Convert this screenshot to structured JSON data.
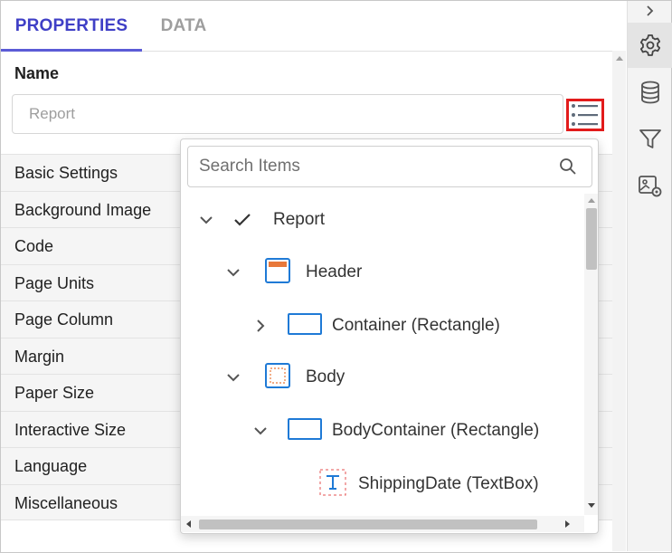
{
  "tabs": [
    {
      "label": "PROPERTIES",
      "active": true
    },
    {
      "label": "DATA",
      "active": false
    }
  ],
  "name_section": {
    "label": "Name",
    "input_value": "Report"
  },
  "property_categories": [
    "Basic Settings",
    "Background Image",
    "Code",
    "Page Units",
    "Page Column",
    "Margin",
    "Paper Size",
    "Interactive Size",
    "Language",
    "Miscellaneous"
  ],
  "item_picker": {
    "search_placeholder": "Search Items",
    "tree": [
      {
        "label": "Report",
        "icon": "check-icon",
        "expanded": true,
        "selected": true
      },
      {
        "label": "Header",
        "icon": "header-section-icon",
        "expanded": true
      },
      {
        "label": "Container (Rectangle)",
        "icon": "rectangle-icon",
        "expanded": false
      },
      {
        "label": "Body",
        "icon": "body-section-icon",
        "expanded": true
      },
      {
        "label": "BodyContainer (Rectangle)",
        "icon": "rectangle-icon",
        "expanded": true
      },
      {
        "label": "ShippingDate (TextBox)",
        "icon": "textbox-icon",
        "expanded": null
      }
    ]
  },
  "right_rail": [
    "collapse-chevron-icon",
    "gear-icon",
    "database-icon",
    "filter-icon",
    "image-settings-icon"
  ],
  "colors": {
    "accent": "#3f3fc6",
    "highlight_border": "#e21b1b",
    "icon_blue": "#1f7ad6",
    "header_orange": "#e8783a"
  }
}
